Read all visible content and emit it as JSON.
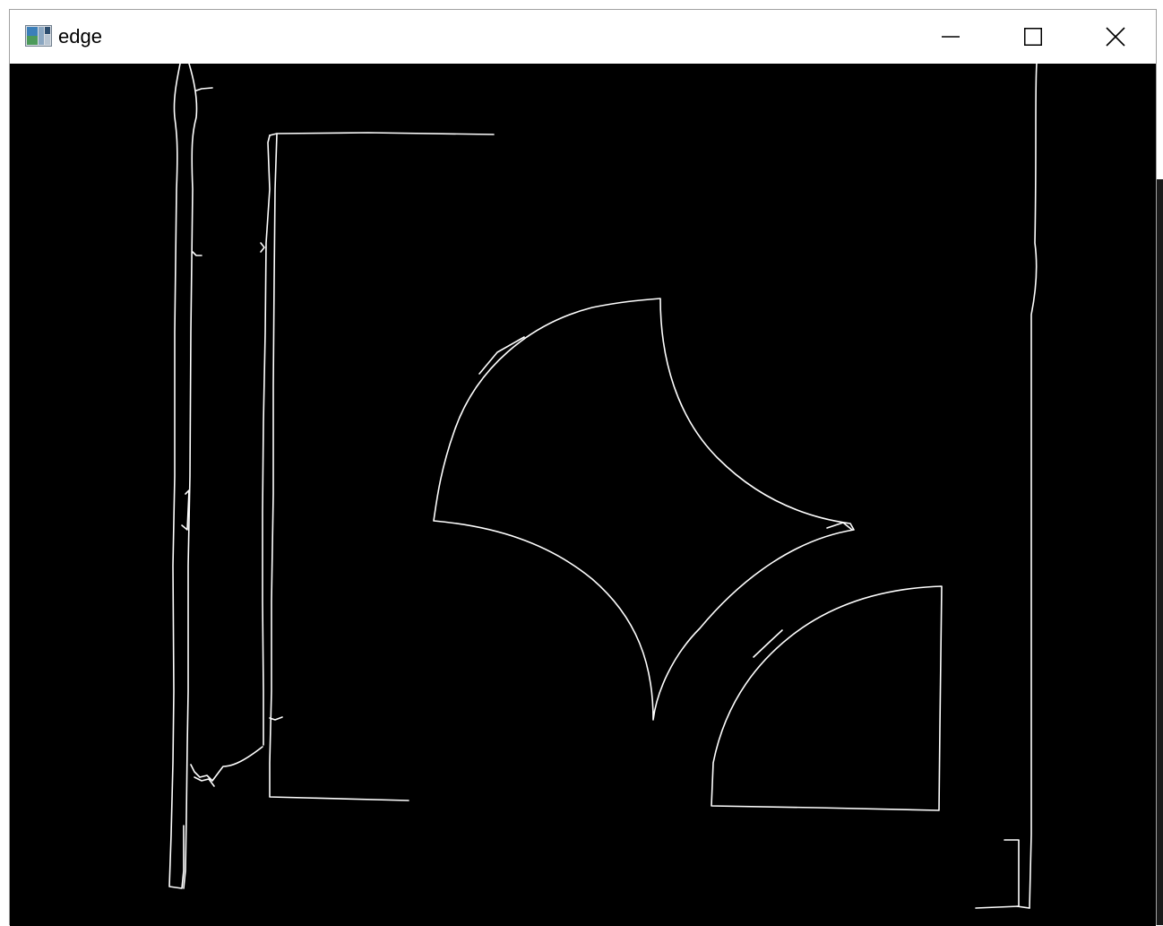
{
  "window": {
    "title": "edge",
    "app_icon": "opencv-window-icon",
    "controls": {
      "minimize_icon": "minimize-icon",
      "maximize_icon": "maximize-icon",
      "close_icon": "close-icon"
    }
  },
  "canvas": {
    "content": "edge-detection-image",
    "background": "#000000",
    "stroke": "#ffffff"
  }
}
